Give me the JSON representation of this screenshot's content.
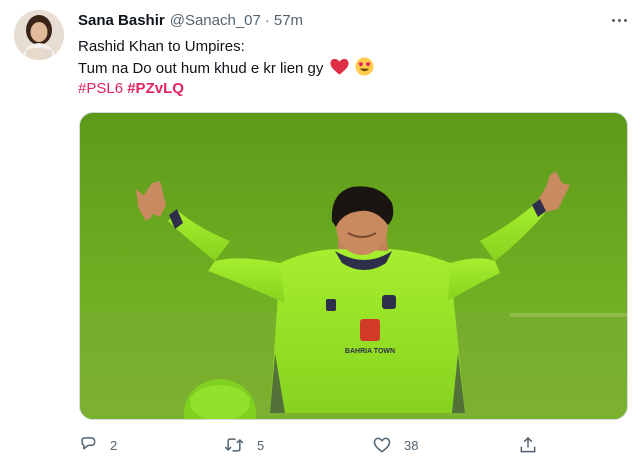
{
  "tweet": {
    "author_name": "Sana Bashir",
    "author_handle": "@Sanach_07",
    "separator": "·",
    "timestamp": "57m",
    "text_line1": "Rashid Khan to Umpires:",
    "text_line2": "Tum na Do out hum khud e kr lien gy",
    "emojis": [
      "red-heart-emoji",
      "heart-eyes-emoji"
    ],
    "hashtags": [
      {
        "label": "#PSL6",
        "bold": false
      },
      {
        "label": "#PZvLQ",
        "bold": true
      }
    ],
    "jersey_text": "BAHRIA TOWN",
    "counts": {
      "replies": "2",
      "retweets": "5",
      "likes": "38"
    }
  },
  "icons": {
    "more": "more-dots-icon",
    "reply": "reply-bubble-icon",
    "retweet": "retweet-arrows-icon",
    "like": "heart-outline-icon",
    "share": "share-upload-icon"
  },
  "colors": {
    "hashtag": "#e0245e",
    "muted": "#536471",
    "text": "#0f1419",
    "jersey_green": "#9be628",
    "pitch_green": "#6aa31f"
  }
}
